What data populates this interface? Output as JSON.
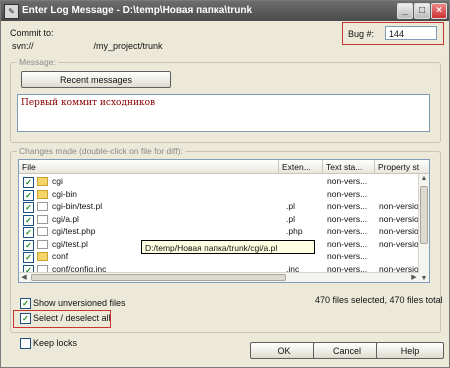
{
  "window": {
    "title": "Enter Log Message - D:\\temp\\Новая папка\\trunk",
    "icon": "app-icon",
    "buttons": {
      "minimize": "_",
      "maximize": "□",
      "close": "×"
    }
  },
  "commit": {
    "label": "Commit to:",
    "url_prefix": "svn://",
    "url_suffix": "/my_project/trunk"
  },
  "bug": {
    "label": "Bug #:",
    "value": "144"
  },
  "message": {
    "group_label": "Message:",
    "recent_button": "Recent messages",
    "text": "Первый коммит исходников"
  },
  "changes": {
    "group_label": "Changes made (double-click on file for diff):",
    "columns": [
      "File",
      "Exten...",
      "Text sta...",
      "Property st"
    ],
    "rows": [
      {
        "name": "cgi",
        "ext": "",
        "status": "non-vers...",
        "prop": "",
        "icon": "folder-icon"
      },
      {
        "name": "cgi-bin",
        "ext": "",
        "status": "non-vers...",
        "prop": "",
        "icon": "folder-icon"
      },
      {
        "name": "cgi-bin/test.pl",
        "ext": ".pl",
        "status": "non-vers...",
        "prop": "non-version",
        "icon": "file-icon"
      },
      {
        "name": "cgi/a.pl",
        "ext": ".pl",
        "status": "non-vers...",
        "prop": "non-version",
        "icon": "file-icon"
      },
      {
        "name": "cgi/test.php",
        "ext": ".php",
        "status": "non-vers...",
        "prop": "non-version",
        "icon": "file-icon"
      },
      {
        "name": "cgi/test.pl",
        "ext": ".pl",
        "status": "non-vers...",
        "prop": "non-version",
        "icon": "file-icon"
      },
      {
        "name": "conf",
        "ext": "",
        "status": "non-vers...",
        "prop": "",
        "icon": "folder-icon"
      },
      {
        "name": "conf/config.inc",
        "ext": ".inc",
        "status": "non-vers...",
        "prop": "non-version",
        "icon": "file-icon"
      }
    ],
    "tooltip": "D:/temp/Новая папка/trunk/cgi/a.pl"
  },
  "options": {
    "show_unversioned": "Show unversioned files",
    "select_all": "Select / deselect all",
    "keep_locks": "Keep locks",
    "selection_status": "470 files selected, 470 files total"
  },
  "buttons": {
    "ok": "OK",
    "cancel": "Cancel",
    "help": "Help"
  },
  "colors": {
    "highlight": "#cc3333",
    "titlebar": "#555555",
    "background": "#ece9d8"
  }
}
